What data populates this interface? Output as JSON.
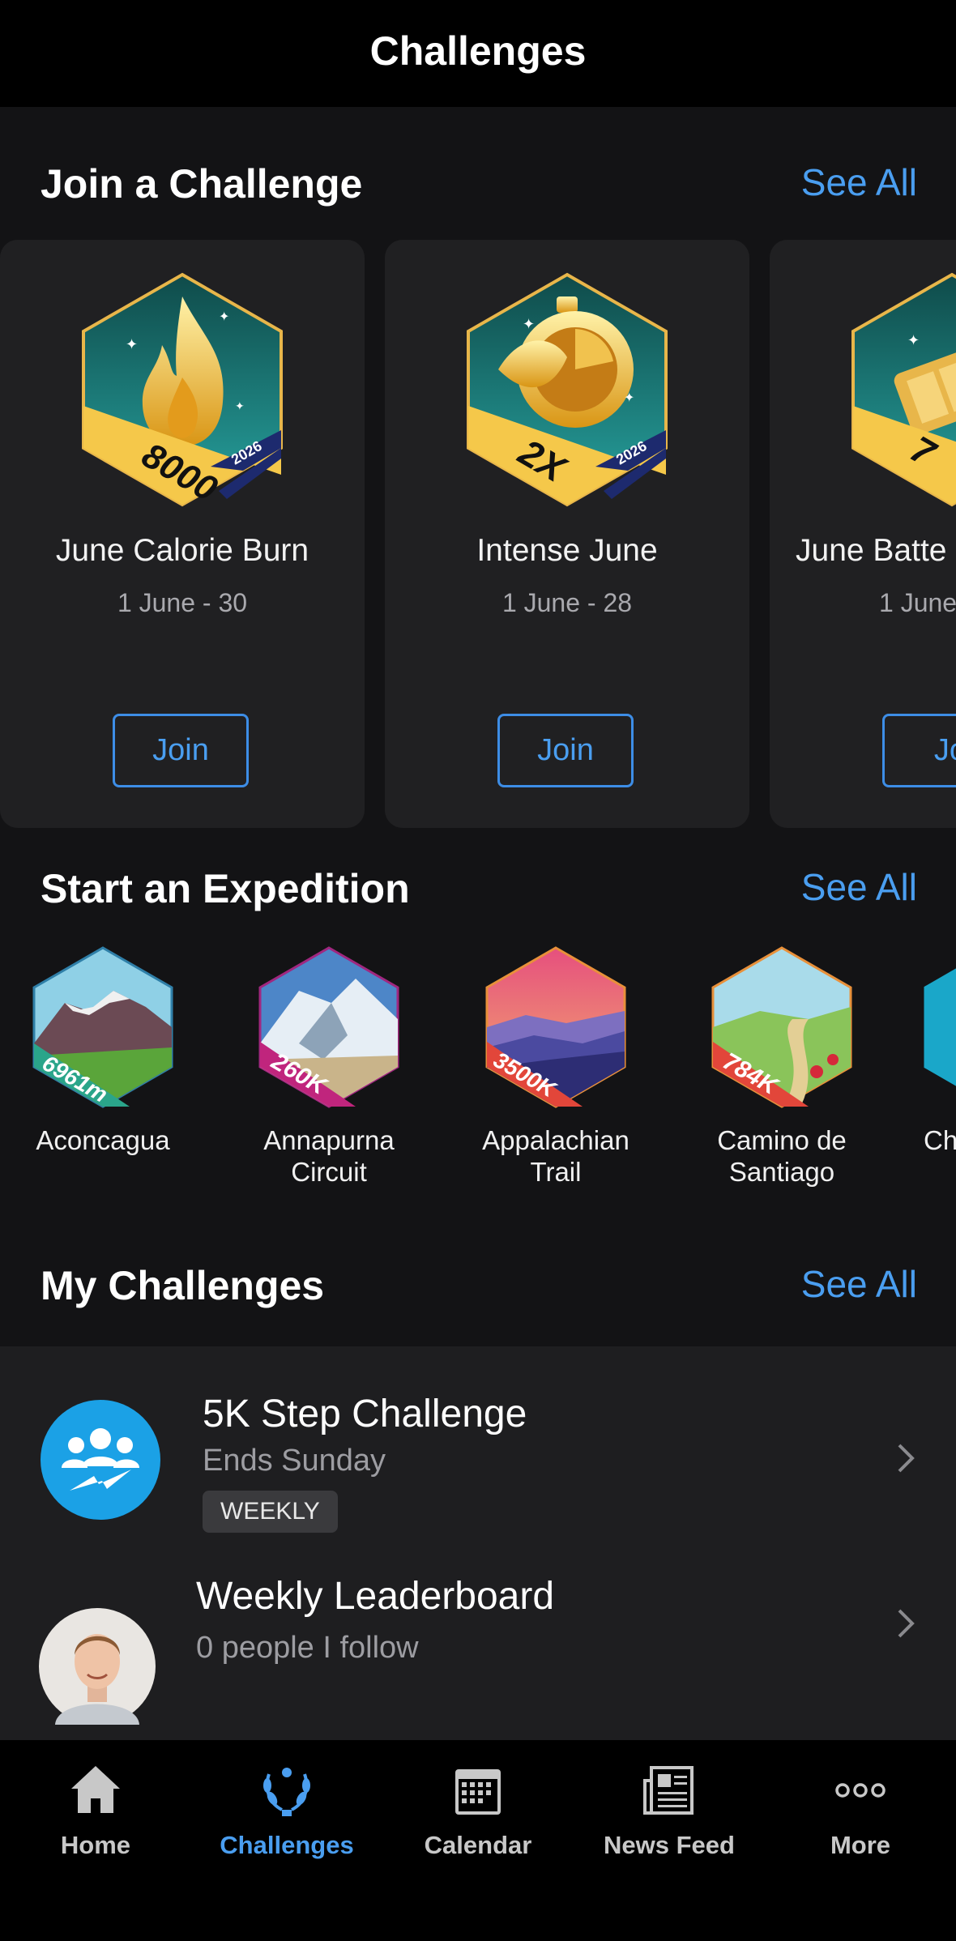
{
  "header": {
    "title": "Challenges"
  },
  "join_section": {
    "title": "Join a Challenge",
    "see_all": "See All",
    "cards": [
      {
        "badge_value": "8000",
        "badge_year": "2026",
        "title": "June Calorie Burn",
        "dates": "1 June - 30",
        "join_label": "Join",
        "icon": "flame-icon"
      },
      {
        "badge_value": "2X",
        "badge_year": "2026",
        "title": "Intense June",
        "dates": "1 June - 28",
        "join_label": "Join",
        "icon": "stopwatch-icon"
      },
      {
        "badge_value": "7",
        "badge_year": "",
        "title": "June Batte",
        "dates": "1 June",
        "join_label": "Jo",
        "icon": "battery-icon"
      }
    ]
  },
  "expedition_section": {
    "title": "Start an Expedition",
    "see_all": "See All",
    "items": [
      {
        "badge": "6961m",
        "label": "Aconcagua",
        "color": "#2aa58a"
      },
      {
        "badge": "260K",
        "label": "Annapurna Circuit",
        "color": "#c0257d"
      },
      {
        "badge": "3500K",
        "label": "Appalachian Trail",
        "color": "#e2463a"
      },
      {
        "badge": "784K",
        "label": "Camino de Santiago",
        "color": "#e2463a"
      },
      {
        "badge": "",
        "label": "Ch",
        "color": "#1aa7c9"
      }
    ]
  },
  "my_challenges": {
    "title": "My Challenges",
    "see_all": "See All",
    "items": [
      {
        "title": "5K Step Challenge",
        "subtitle": "Ends Sunday",
        "tag": "WEEKLY",
        "icon": "group-challenge-icon"
      },
      {
        "title": "Weekly Leaderboard",
        "subtitle": "0 people I follow",
        "icon": "avatar"
      }
    ]
  },
  "tabbar": {
    "tabs": [
      {
        "label": "Home",
        "icon": "home-icon",
        "active": false
      },
      {
        "label": "Challenges",
        "icon": "laurel-icon",
        "active": true
      },
      {
        "label": "Calendar",
        "icon": "calendar-icon",
        "active": false
      },
      {
        "label": "News Feed",
        "icon": "newspaper-icon",
        "active": false
      },
      {
        "label": "More",
        "icon": "more-icon",
        "active": false
      }
    ]
  },
  "colors": {
    "accent": "#4a9ef0",
    "background": "#131315",
    "card": "#202022"
  }
}
